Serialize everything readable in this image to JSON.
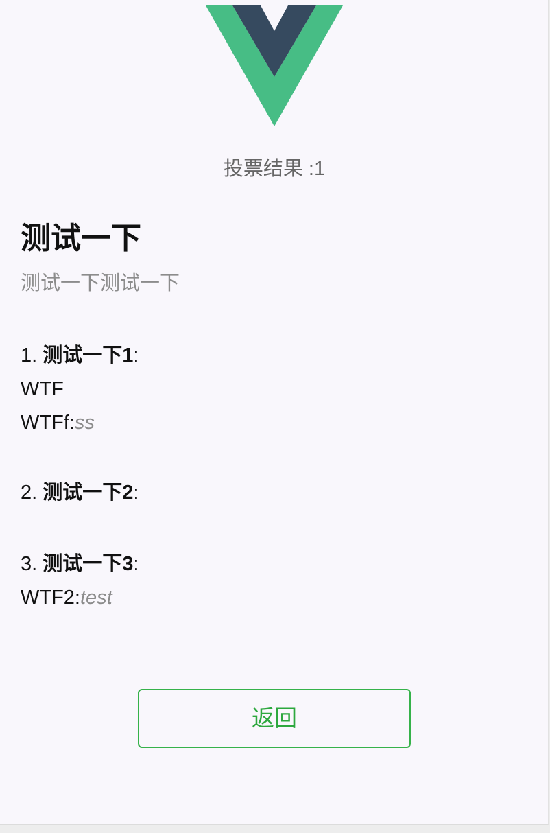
{
  "header": {
    "logo_icon": "vue-logo-icon",
    "result_label": "投票结果 :1"
  },
  "survey": {
    "title": "测试一下",
    "description": "测试一下测试一下"
  },
  "questions": [
    {
      "number": "1.",
      "label": "测试一下1",
      "colon": ":",
      "answers": [
        {
          "text": "WTF",
          "extra": ""
        },
        {
          "text": "WTFf:",
          "extra": "ss"
        }
      ]
    },
    {
      "number": "2.",
      "label": "测试一下2",
      "colon": ":",
      "answers": []
    },
    {
      "number": "3.",
      "label": "测试一下3",
      "colon": ":",
      "answers": [
        {
          "text": "WTF2:",
          "extra": "test"
        }
      ]
    }
  ],
  "actions": {
    "back_label": "返回"
  },
  "colors": {
    "page_background": "#f9f7fc",
    "logo_green": "#47bd85",
    "logo_dark": "#364a5f",
    "button_green": "#36b24a",
    "muted_text": "#8c8c8c"
  }
}
